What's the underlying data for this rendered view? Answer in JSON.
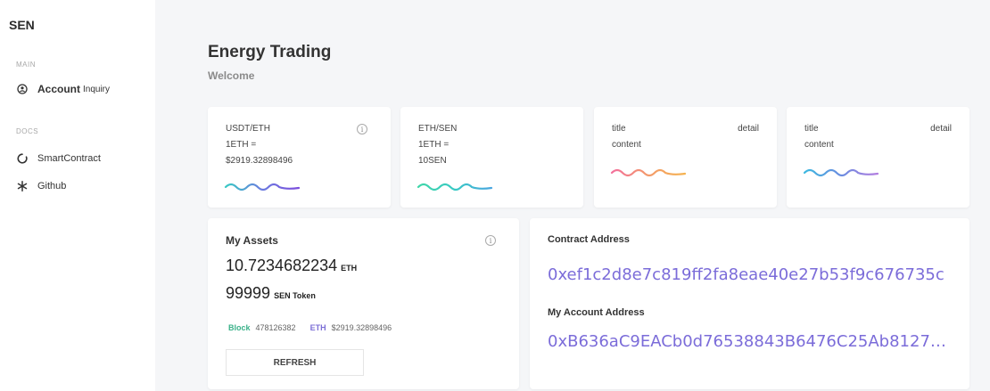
{
  "sidebar": {
    "brand": "SEN",
    "main_label": "MAIN",
    "docs_label": "DOCS",
    "account_strong": "Account",
    "account_sub": "Inquiry",
    "smartcontract": "SmartContract",
    "github": "Github"
  },
  "header": {
    "title": "Energy Trading",
    "subtitle": "Welcome"
  },
  "cards": [
    {
      "l1": "USDT/ETH",
      "l2": "1ETH =",
      "l3": "$2919.32898496",
      "wave_colors": [
        "#38c9c4",
        "#6b7be0",
        "#7c4ddc"
      ]
    },
    {
      "l1": "ETH/SEN",
      "l2": "1ETH =",
      "l3": "10SEN",
      "wave_colors": [
        "#3fd6a8",
        "#38c9c4",
        "#4aa6e0"
      ]
    },
    {
      "l1": "title",
      "l2": "content",
      "detail": "detail",
      "wave_colors": [
        "#f36f9c",
        "#f39a6a",
        "#f5b24e"
      ]
    },
    {
      "l1": "title",
      "l2": "content",
      "detail": "detail",
      "wave_colors": [
        "#3cb8e0",
        "#6a8ce0",
        "#b27de0"
      ]
    }
  ],
  "assets": {
    "title": "My Assets",
    "eth_amount": "10.7234682234",
    "eth_unit": "ETH",
    "sen_amount": "99999",
    "sen_unit": "SEN Token",
    "block_label": "Block",
    "block_value": "478126382",
    "eth_label": "ETH",
    "eth_value": "$2919.32898496",
    "refresh_label": "REFRESH"
  },
  "contract": {
    "label": "Contract Address",
    "address": "0xef1c2d8e7c819ff2fa8eae40e27b53f9c676735c",
    "account_label": "My Account Address",
    "account_address": "0xB636aC9EACb0d76538843B6476C25Ab81273..."
  },
  "colors": {
    "accent_purple": "#7b6cd9",
    "accent_green": "#3bb28a"
  }
}
